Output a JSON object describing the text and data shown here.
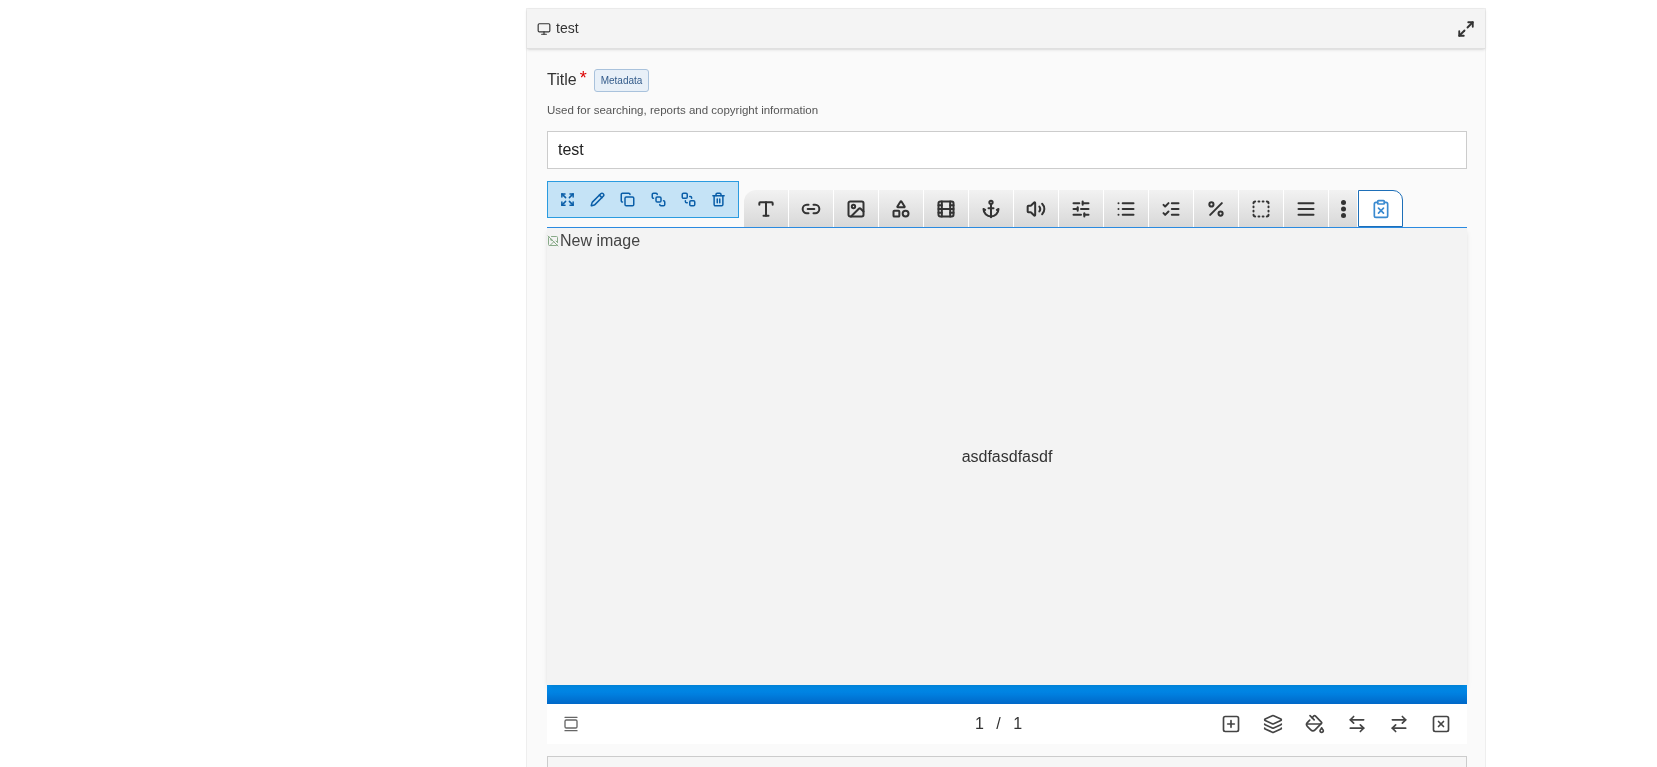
{
  "panel": {
    "title": "test"
  },
  "field": {
    "label": "Title",
    "required_mark": "*",
    "badge": "Metadata",
    "hint": "Used for searching, reports and copyright information",
    "value": "test"
  },
  "canvas": {
    "image_alt": "New image",
    "text": "asdfasdfasdf"
  },
  "footer": {
    "page": "1 / 1"
  }
}
